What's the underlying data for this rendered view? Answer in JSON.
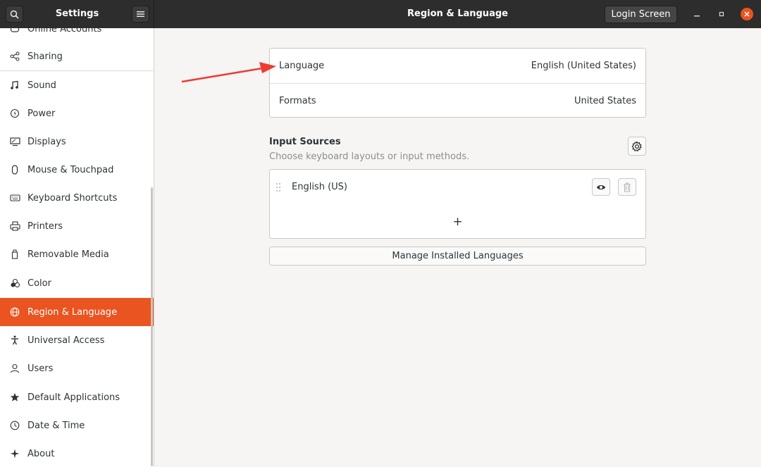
{
  "sidebar_title": "Settings",
  "main_title": "Region & Language",
  "login_screen_label": "Login Screen",
  "sidebar": {
    "partial_item": "Online Accounts",
    "items": [
      {
        "label": "Sharing",
        "icon": "share-icon"
      },
      {
        "label": "Sound",
        "icon": "music-note-icon"
      },
      {
        "label": "Power",
        "icon": "power-icon"
      },
      {
        "label": "Displays",
        "icon": "display-icon"
      },
      {
        "label": "Mouse & Touchpad",
        "icon": "mouse-icon"
      },
      {
        "label": "Keyboard Shortcuts",
        "icon": "keyboard-icon"
      },
      {
        "label": "Printers",
        "icon": "printer-icon"
      },
      {
        "label": "Removable Media",
        "icon": "removable-media-icon"
      },
      {
        "label": "Color",
        "icon": "color-icon"
      },
      {
        "label": "Region & Language",
        "icon": "globe-icon",
        "active": true
      },
      {
        "label": "Universal Access",
        "icon": "accessibility-icon"
      },
      {
        "label": "Users",
        "icon": "user-icon"
      },
      {
        "label": "Default Applications",
        "icon": "star-icon"
      },
      {
        "label": "Date & Time",
        "icon": "clock-icon"
      },
      {
        "label": "About",
        "icon": "about-icon"
      }
    ]
  },
  "region": {
    "language_label": "Language",
    "language_value": "English (United States)",
    "formats_label": "Formats",
    "formats_value": "United States"
  },
  "input_sources": {
    "title": "Input Sources",
    "subtitle": "Choose keyboard layouts or input methods.",
    "items": [
      {
        "label": "English (US)"
      }
    ],
    "add_label": "+"
  },
  "manage_languages_label": "Manage Installed Languages",
  "colors": {
    "accent": "#e95420",
    "header": "#2d2d2d",
    "annotation_arrow": "#ee3b33"
  }
}
